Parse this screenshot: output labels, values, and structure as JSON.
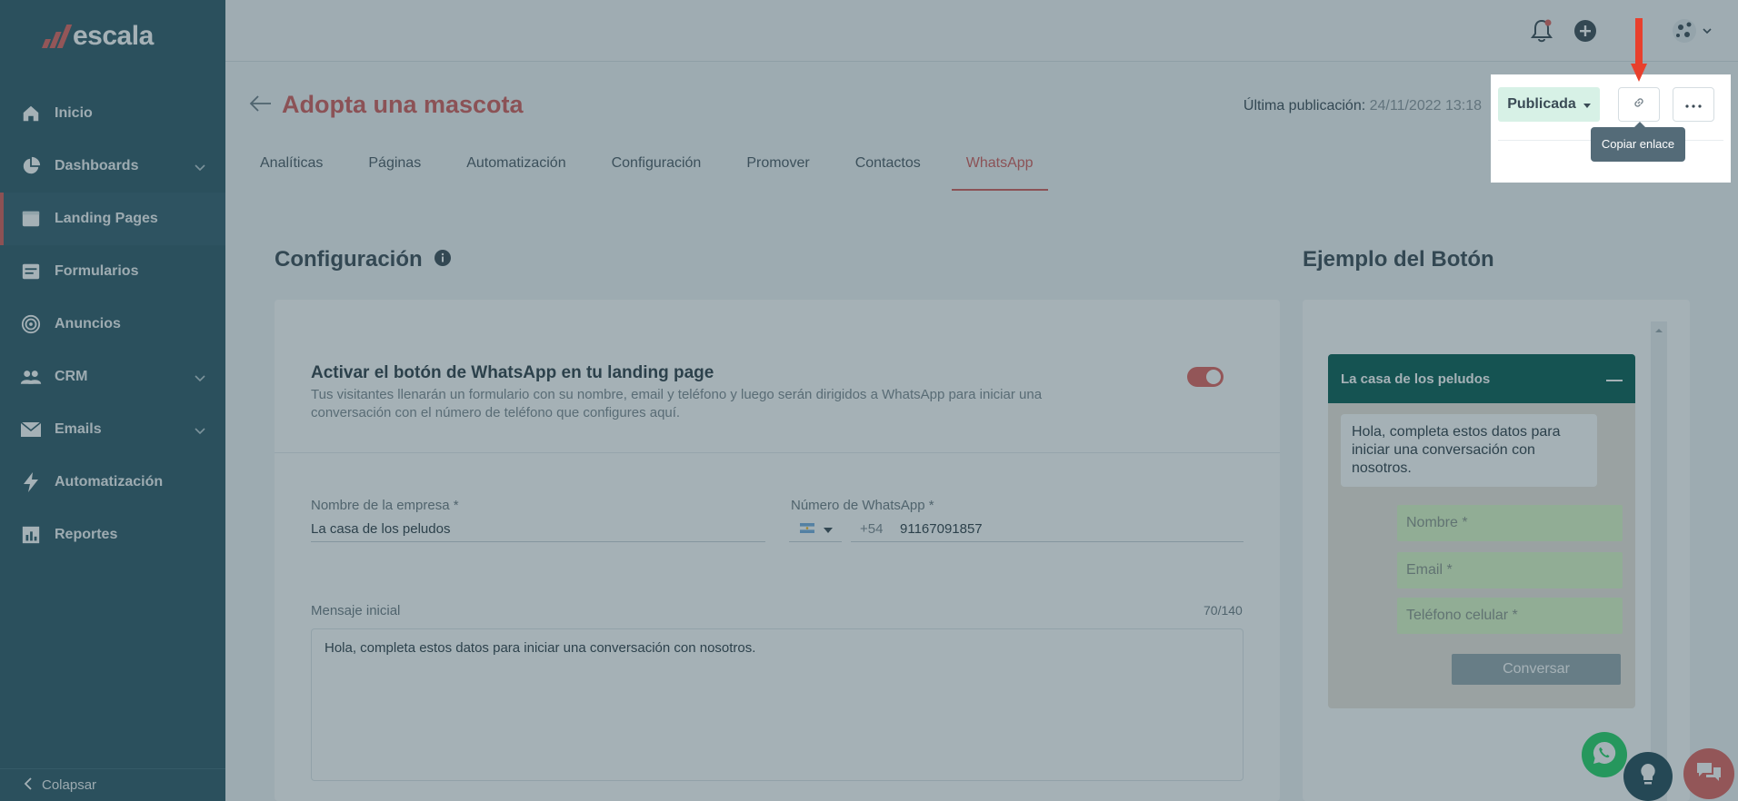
{
  "brand": {
    "name": "escala"
  },
  "sidebar": {
    "items": [
      {
        "label": "Inicio",
        "icon": "home-icon",
        "has_children": false
      },
      {
        "label": "Dashboards",
        "icon": "pie-chart-icon",
        "has_children": true
      },
      {
        "label": "Landing Pages",
        "icon": "browser-window-icon",
        "has_children": false,
        "active": true
      },
      {
        "label": "Formularios",
        "icon": "form-icon",
        "has_children": false
      },
      {
        "label": "Anuncios",
        "icon": "target-icon",
        "has_children": false
      },
      {
        "label": "CRM",
        "icon": "users-icon",
        "has_children": true
      },
      {
        "label": "Emails",
        "icon": "envelope-icon",
        "has_children": true
      },
      {
        "label": "Automatización",
        "icon": "bolt-icon",
        "has_children": false
      },
      {
        "label": "Reportes",
        "icon": "bar-chart-icon",
        "has_children": false
      }
    ],
    "collapse_label": "Colapsar"
  },
  "header": {
    "title": "Adopta una mascota",
    "last_publication_label": "Última publicación:",
    "last_publication_date": "24/11/2022 13:18",
    "status_label": "Publicada",
    "copy_link_tooltip": "Copiar enlace"
  },
  "tabs": [
    {
      "label": "Analíticas"
    },
    {
      "label": "Páginas"
    },
    {
      "label": "Automatización"
    },
    {
      "label": "Configuración"
    },
    {
      "label": "Promover"
    },
    {
      "label": "Contactos"
    },
    {
      "label": "WhatsApp",
      "active": true
    }
  ],
  "config": {
    "section_title": "Configuración",
    "toggle_title": "Activar el botón de WhatsApp en tu landing page",
    "toggle_description": "Tus visitantes llenarán un formulario con su nombre, email y teléfono y luego serán dirigidos a WhatsApp para iniciar una conversación con el número de teléfono que configures aquí.",
    "toggle_on": true,
    "company_label": "Nombre de la empresa *",
    "company_value": "La casa de los peludos",
    "whatsapp_label": "Número de WhatsApp *",
    "country_code": "+54",
    "phone_value": "91167091857",
    "message_label": "Mensaje inicial",
    "message_count": "70/140",
    "message_value": "Hola, completa estos datos para iniciar una conversación con nosotros."
  },
  "preview": {
    "section_title": "Ejemplo del Botón",
    "chat_title": "La casa de los peludos",
    "bubble_text": "Hola, completa estos datos para iniciar una conversación con nosotros.",
    "name_placeholder": "Nombre *",
    "email_placeholder": "Email *",
    "phone_placeholder": "Teléfono celular *",
    "submit_label": "Conversar"
  },
  "colors": {
    "sidebar": "#2e5866",
    "accent": "#d35c5a",
    "status_badge": "#d7f1e6",
    "whatsapp_header": "#075e54",
    "whatsapp_input": "#dcf8c6"
  }
}
